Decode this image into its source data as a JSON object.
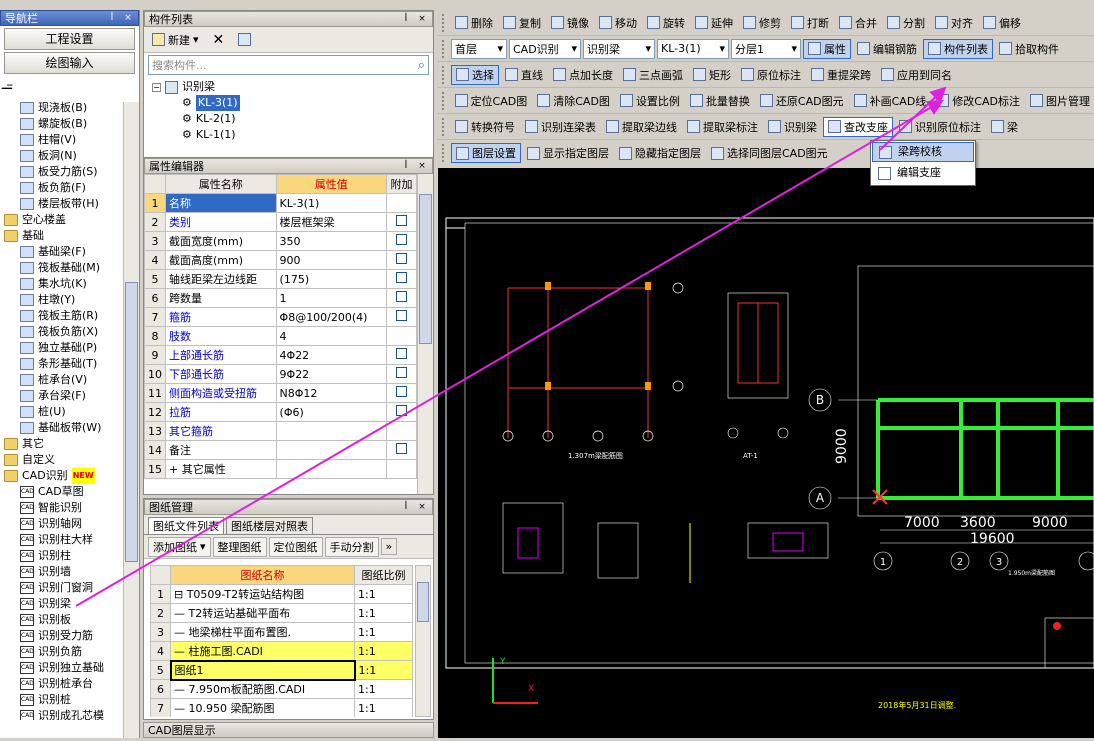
{
  "nav": {
    "title": "导航栏",
    "buttons": [
      "工程设置",
      "绘图输入"
    ],
    "tree": [
      {
        "label": "现浇板(B)",
        "indent": 2
      },
      {
        "label": "螺旋板(B)",
        "indent": 2
      },
      {
        "label": "柱帽(V)",
        "indent": 2
      },
      {
        "label": "板洞(N)",
        "indent": 2
      },
      {
        "label": "板受力筋(S)",
        "indent": 2
      },
      {
        "label": "板负筋(F)",
        "indent": 2
      },
      {
        "label": "楼层板带(H)",
        "indent": 2
      },
      {
        "label": "空心楼盖",
        "indent": 0,
        "folder": true
      },
      {
        "label": "基础",
        "indent": 0,
        "folder": true
      },
      {
        "label": "基础梁(F)",
        "indent": 2
      },
      {
        "label": "筏板基础(M)",
        "indent": 2
      },
      {
        "label": "集水坑(K)",
        "indent": 2
      },
      {
        "label": "柱墩(Y)",
        "indent": 2
      },
      {
        "label": "筏板主筋(R)",
        "indent": 2
      },
      {
        "label": "筏板负筋(X)",
        "indent": 2
      },
      {
        "label": "独立基础(P)",
        "indent": 2
      },
      {
        "label": "条形基础(T)",
        "indent": 2
      },
      {
        "label": "桩承台(V)",
        "indent": 2
      },
      {
        "label": "承台梁(F)",
        "indent": 2
      },
      {
        "label": "桩(U)",
        "indent": 2
      },
      {
        "label": "基础板带(W)",
        "indent": 2
      },
      {
        "label": "其它",
        "indent": 0,
        "folder": true
      },
      {
        "label": "自定义",
        "indent": 0,
        "folder": true
      },
      {
        "label": "CAD识别",
        "indent": 0,
        "folder": true,
        "badge": "NEW"
      },
      {
        "label": "CAD草图",
        "indent": 2,
        "cad": true
      },
      {
        "label": "智能识别",
        "indent": 2,
        "cad": true
      },
      {
        "label": "识别轴网",
        "indent": 2,
        "cad": true
      },
      {
        "label": "识别柱大样",
        "indent": 2,
        "cad": true
      },
      {
        "label": "识别柱",
        "indent": 2,
        "cad": true
      },
      {
        "label": "识别墙",
        "indent": 2,
        "cad": true
      },
      {
        "label": "识别门窗洞",
        "indent": 2,
        "cad": true
      },
      {
        "label": "识别梁",
        "indent": 2,
        "cad": true
      },
      {
        "label": "识别板",
        "indent": 2,
        "cad": true
      },
      {
        "label": "识别受力筋",
        "indent": 2,
        "cad": true
      },
      {
        "label": "识别负筋",
        "indent": 2,
        "cad": true
      },
      {
        "label": "识别独立基础",
        "indent": 2,
        "cad": true
      },
      {
        "label": "识别桩承台",
        "indent": 2,
        "cad": true
      },
      {
        "label": "识别桩",
        "indent": 2,
        "cad": true
      },
      {
        "label": "识别成孔芯模",
        "indent": 2,
        "cad": true
      }
    ]
  },
  "comp": {
    "title": "构件列表",
    "new_label": "新建",
    "search_placeholder": "搜索构件...",
    "root": "识别梁",
    "items": [
      "KL-3(1)",
      "KL-2(1)",
      "KL-1(1)"
    ]
  },
  "prop": {
    "title": "属性编辑器",
    "headers": [
      "属性名称",
      "属性值",
      "附加"
    ],
    "rows": [
      {
        "n": "1",
        "name": "名称",
        "val": "KL-3(1)",
        "chk": false,
        "blue": true
      },
      {
        "n": "2",
        "name": "类别",
        "val": "楼层框架梁",
        "chk": true,
        "blue": true
      },
      {
        "n": "3",
        "name": "截面宽度(mm)",
        "val": "350",
        "chk": true,
        "blue": false
      },
      {
        "n": "4",
        "name": "截面高度(mm)",
        "val": "900",
        "chk": true,
        "blue": false
      },
      {
        "n": "5",
        "name": "轴线距梁左边线距",
        "val": "(175)",
        "chk": true,
        "blue": false
      },
      {
        "n": "6",
        "name": "跨数量",
        "val": "1",
        "chk": true,
        "blue": false
      },
      {
        "n": "7",
        "name": "箍筋",
        "val": "Φ8@100/200(4)",
        "chk": true,
        "blue": true
      },
      {
        "n": "8",
        "name": "肢数",
        "val": "4",
        "chk": false,
        "blue": true
      },
      {
        "n": "9",
        "name": "上部通长筋",
        "val": "4Φ22",
        "chk": true,
        "blue": true
      },
      {
        "n": "10",
        "name": "下部通长筋",
        "val": "9Φ22",
        "chk": true,
        "blue": true
      },
      {
        "n": "11",
        "name": "侧面构造或受扭筋",
        "val": "N8Φ12",
        "chk": true,
        "blue": true
      },
      {
        "n": "12",
        "name": "拉筋",
        "val": "(Φ6)",
        "chk": true,
        "blue": true
      },
      {
        "n": "13",
        "name": "其它箍筋",
        "val": "",
        "chk": false,
        "blue": true
      },
      {
        "n": "14",
        "name": "备注",
        "val": "",
        "chk": true,
        "blue": false
      },
      {
        "n": "15",
        "name": "+ 其它属性",
        "val": "",
        "chk": false,
        "blue": false
      }
    ]
  },
  "draw": {
    "title": "图纸管理",
    "tabs": [
      "图纸文件列表",
      "图纸楼层对照表"
    ],
    "buttons": [
      "添加图纸",
      "整理图纸",
      "定位图纸",
      "手动分割"
    ],
    "headers": [
      "图纸名称",
      "图纸比例"
    ],
    "rows": [
      {
        "n": "1",
        "name": "⊟ T0509-T2转运站结构图",
        "scale": "1:1",
        "hl": false
      },
      {
        "n": "2",
        "name": "— T2转运站基础平面布",
        "scale": "1:1",
        "hl": false
      },
      {
        "n": "3",
        "name": "— 地梁梯柱平面布置图.",
        "scale": "1:1",
        "hl": false
      },
      {
        "n": "4",
        "name": "— 柱施工图.CADI",
        "scale": "1:1",
        "hl": true
      },
      {
        "n": "5",
        "name": "图纸1",
        "scale": "1:1",
        "hl": true
      },
      {
        "n": "6",
        "name": "— 7.950m板配筋图.CADI",
        "scale": "1:1",
        "hl": false
      },
      {
        "n": "7",
        "name": "— 10.950 梁配筋图",
        "scale": "1:1",
        "hl": false
      }
    ]
  },
  "cadlayer_title": "CAD图层显示",
  "toolbar": {
    "row1": [
      "删除",
      "复制",
      "镜像",
      "移动",
      "旋转",
      "延伸",
      "修剪",
      "打断",
      "合并",
      "分割",
      "对齐",
      "偏移"
    ],
    "row2": {
      "floor": "首层",
      "mode": "CAD识别",
      "type": "识别梁",
      "comp": "KL-3(1)",
      "layer": "分层1",
      "btns": [
        "属性",
        "编辑钢筋",
        "构件列表",
        "拾取构件"
      ]
    },
    "row3": [
      "选择",
      "直线",
      "点加长度",
      "三点画弧",
      "矩形",
      "原位标注",
      "重提梁跨",
      "应用到同名"
    ],
    "row4": [
      "定位CAD图",
      "清除CAD图",
      "设置比例",
      "批量替换",
      "还原CAD图元",
      "补画CAD线",
      "修改CAD标注",
      "图片管理"
    ],
    "row5": [
      "转换符号",
      "识别连梁表",
      "提取梁边线",
      "提取梁标注",
      "识别梁",
      "查改支座",
      "识别原位标注",
      "梁"
    ],
    "row6": [
      "图层设置",
      "显示指定图层",
      "隐藏指定图层",
      "选择同图层CAD图元"
    ]
  },
  "dropdown": {
    "items": [
      "梁跨校核",
      "编辑支座"
    ]
  },
  "canvas": {
    "dims_bottom": [
      "7000",
      "3600",
      "9000"
    ],
    "dim_total": "19600",
    "dim_left": "9000",
    "axes_letters": [
      "B",
      "A"
    ],
    "axes_numbers": [
      "1",
      "2",
      "3"
    ],
    "note": "2018年5月31日调整.",
    "label_1": "1.307m梁配筋图",
    "label_2": "1.950m梁配筋图",
    "label_3": "AT-1"
  },
  "colors": {
    "accent": "#316ac5",
    "highlight": "#ffff66",
    "arrow": "#e020e0"
  }
}
